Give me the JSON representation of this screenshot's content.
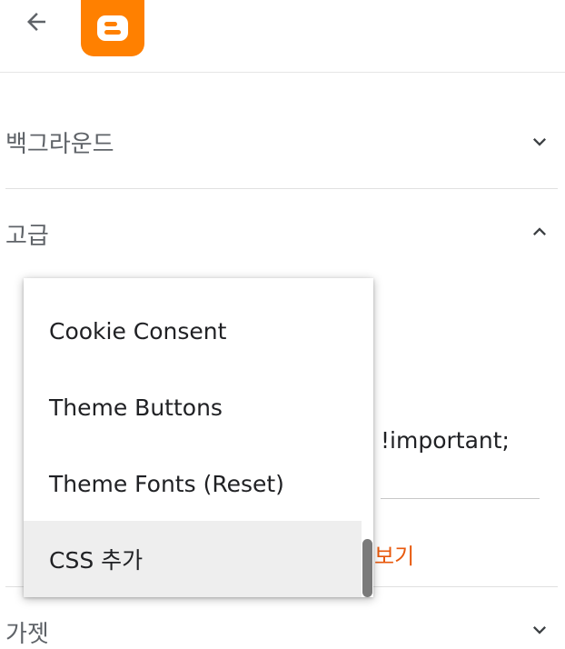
{
  "colors": {
    "brand": "#ff8000",
    "accent_link": "#e8590c",
    "selected_item": "#eeeeee",
    "divider": "#e0e0e0"
  },
  "topbar": {
    "back_icon": "arrow-left-icon",
    "logo_icon": "blogger-logo-icon"
  },
  "sections": {
    "background": {
      "title": "백그라운드",
      "icon": "chevron-down-icon"
    },
    "advanced": {
      "title": "고급",
      "icon": "chevron-up-icon"
    },
    "gadget": {
      "title": "가젯",
      "icon": "chevron-down-icon"
    }
  },
  "advanced_panel": {
    "css_value_partial": "!important;",
    "link_partial": "보기"
  },
  "dropdown": {
    "items": [
      {
        "label": "Cookie Consent"
      },
      {
        "label": "Theme Buttons"
      },
      {
        "label": "Theme Fonts (Reset)"
      },
      {
        "label": "CSS 추가",
        "selected": true
      }
    ]
  }
}
